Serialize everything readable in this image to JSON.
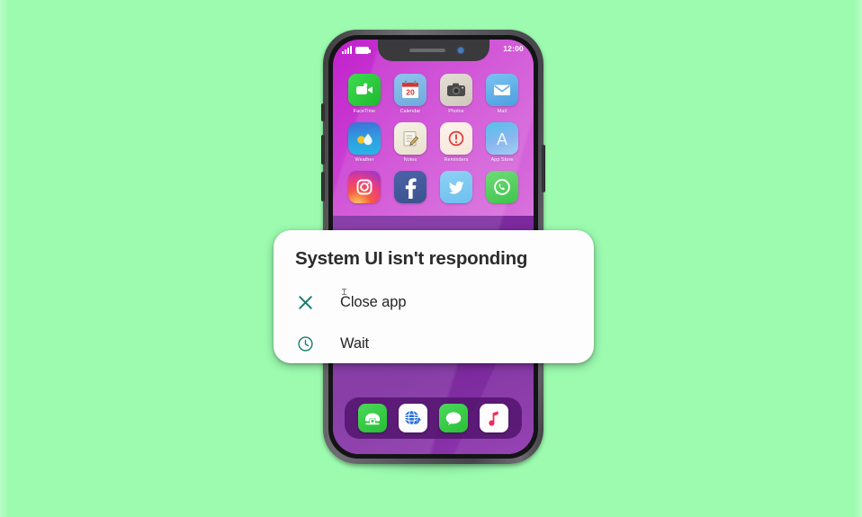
{
  "background": {
    "color": "#9CFBAF"
  },
  "phone": {
    "frame_color": "#55555a",
    "screen_gradient_top": "#c021cc",
    "screen_gradient_bottom": "#e197e3",
    "screen_lower_color": "#7c2a9e",
    "dock_color": "#541670",
    "status_bar": {
      "time": "12:00",
      "signal_icon": "signal-bars-icon",
      "battery_icon": "battery-icon"
    },
    "notch": {
      "speaker_icon": "speaker-grille-icon",
      "camera_icon": "front-camera-icon"
    },
    "side_buttons": [
      {
        "name": "mute-switch"
      },
      {
        "name": "volume-up-button"
      },
      {
        "name": "volume-down-button"
      },
      {
        "name": "power-button"
      }
    ],
    "app_rows": [
      [
        {
          "label": "FaceTime",
          "icon": "facetime-video-camera-icon"
        },
        {
          "label": "Calendar",
          "icon": "calendar-icon",
          "day": "20"
        },
        {
          "label": "Photos",
          "icon": "camera-icon"
        },
        {
          "label": "Mail",
          "icon": "envelope-icon"
        }
      ],
      [
        {
          "label": "Weather",
          "icon": "sun-and-raindrop-icon"
        },
        {
          "label": "Notes",
          "icon": "notepad-pencil-icon"
        },
        {
          "label": "Reminders",
          "icon": "exclamation-circle-icon"
        },
        {
          "label": "App Store",
          "icon": "letter-a-icon"
        }
      ],
      [
        {
          "label": "",
          "icon": "instagram-camera-icon"
        },
        {
          "label": "",
          "icon": "facebook-f-icon"
        },
        {
          "label": "",
          "icon": "twitter-bird-icon"
        },
        {
          "label": "",
          "icon": "whatsapp-phone-icon"
        }
      ]
    ],
    "dock_apps": [
      {
        "label": "Phone",
        "icon": "telephone-icon"
      },
      {
        "label": "Browser",
        "icon": "globe-refresh-icon"
      },
      {
        "label": "Messages",
        "icon": "speech-bubble-icon"
      },
      {
        "label": "Music",
        "icon": "music-note-icon"
      }
    ]
  },
  "dialog": {
    "title": "System UI isn't responding",
    "accent_color": "#127a6b",
    "background_color": "#fdfdfd",
    "actions": [
      {
        "label": "Close app",
        "icon": "close-x-icon"
      },
      {
        "label": "Wait",
        "icon": "clock-icon"
      }
    ]
  }
}
